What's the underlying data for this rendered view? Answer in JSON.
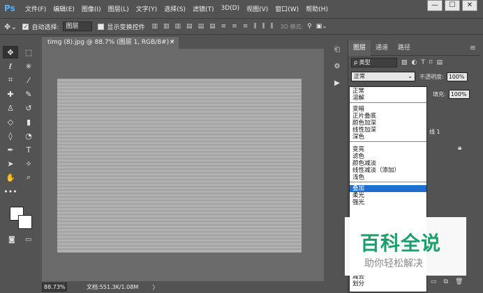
{
  "app": {
    "logo": "Ps"
  },
  "menu": {
    "items": [
      "文件(F)",
      "编辑(E)",
      "图像(I)",
      "图层(L)",
      "文字(Y)",
      "选择(S)",
      "滤镜(T)",
      "3D(D)",
      "视图(V)",
      "窗口(W)",
      "帮助(H)"
    ]
  },
  "window_controls": {
    "minimize": "—",
    "maximize": "☐",
    "close": "✕"
  },
  "options": {
    "auto_select_label": "自动选择:",
    "auto_select_value": "图层",
    "show_transform_label": "显示变换控件",
    "mode_label": "3D 模式:"
  },
  "document": {
    "tab_title": "timg (8).jpg @ 88.7% (图层 1, RGB/8#) *",
    "close": "×"
  },
  "status": {
    "zoom": "88.73%",
    "doc_info": "文档:551.3K/1.08M",
    "arrow": "〉"
  },
  "layers_panel": {
    "tabs": [
      "图层",
      "通道",
      "路径"
    ],
    "filter_value": "ρ 类型",
    "blend_value": "正常",
    "opacity_label": "不透明度:",
    "opacity_value": "100%",
    "fill_label": "填充:",
    "fill_value": "100%",
    "layer_name_partial": "线 1"
  },
  "blend_modes": {
    "groups": [
      [
        "正常",
        "溶解"
      ],
      [
        "变暗",
        "正片叠底",
        "颜色加深",
        "线性加深",
        "深色"
      ],
      [
        "变亮",
        "滤色",
        "颜色减淡",
        "线性减淡（添加）",
        "浅色"
      ],
      [
        "叠加",
        "柔光",
        "强光"
      ]
    ],
    "tail": [
      "减去",
      "划分"
    ],
    "selected": "叠加"
  },
  "watermark": {
    "title": "百科全说",
    "subtitle": "助你轻松解决"
  },
  "colors": {
    "ui_bg": "#535353",
    "canvas_bg": "#6b6b6b",
    "selection": "#1f6fd1",
    "watermark_green": "#1aa06a"
  }
}
